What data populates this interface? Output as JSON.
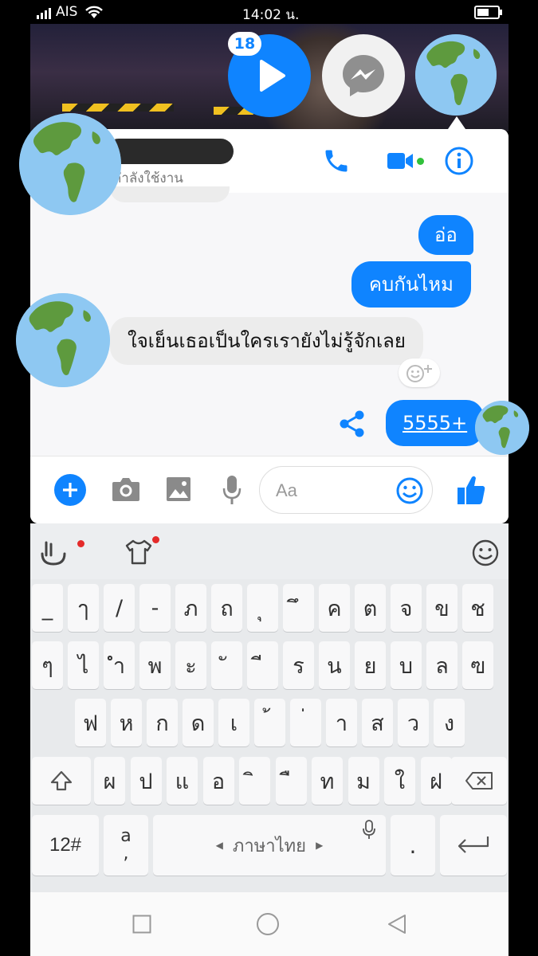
{
  "status_bar": {
    "carrier": "AIS",
    "time": "14:02 น."
  },
  "chat_heads": {
    "badge_count": "18"
  },
  "header": {
    "status": "กำลังใช้งาน"
  },
  "messages": [
    {
      "from": "me",
      "text": "อ่อ"
    },
    {
      "from": "me",
      "text": "คบกันไหม"
    },
    {
      "from": "them",
      "text": "ใจเย็นเธอเป็นใครเรายังไม่รู้จักเลย"
    },
    {
      "from": "me",
      "text": "5555+"
    }
  ],
  "composer": {
    "placeholder": "Aa"
  },
  "keyboard": {
    "row1": [
      "_",
      "ๅ",
      "/",
      "-",
      "ภ",
      "ถ",
      "ุ",
      "ึ",
      "ค",
      "ต",
      "จ",
      "ข",
      "ช"
    ],
    "row2": [
      "ๆ",
      "ไ",
      "ำ",
      "พ",
      "ะ",
      "ั",
      "ี",
      "ร",
      "น",
      "ย",
      "บ",
      "ล",
      "ฃ"
    ],
    "row3": [
      "ฟ",
      "ห",
      "ก",
      "ด",
      "เ",
      "้",
      "่",
      "า",
      "ส",
      "ว",
      "ง"
    ],
    "row4": [
      "ผ",
      "ป",
      "แ",
      "อ",
      "ิ",
      "ื",
      "ท",
      "ม",
      "ใ",
      "ฝ"
    ],
    "numbers_key": "12#",
    "lang_switch_top": "a",
    "lang_switch_bottom": ",",
    "space_label": "ภาษาไทย",
    "period": "."
  },
  "colors": {
    "messenger_blue": "#0f84ff",
    "online_green": "#31c13b",
    "badge_red": "#e42a2a"
  }
}
